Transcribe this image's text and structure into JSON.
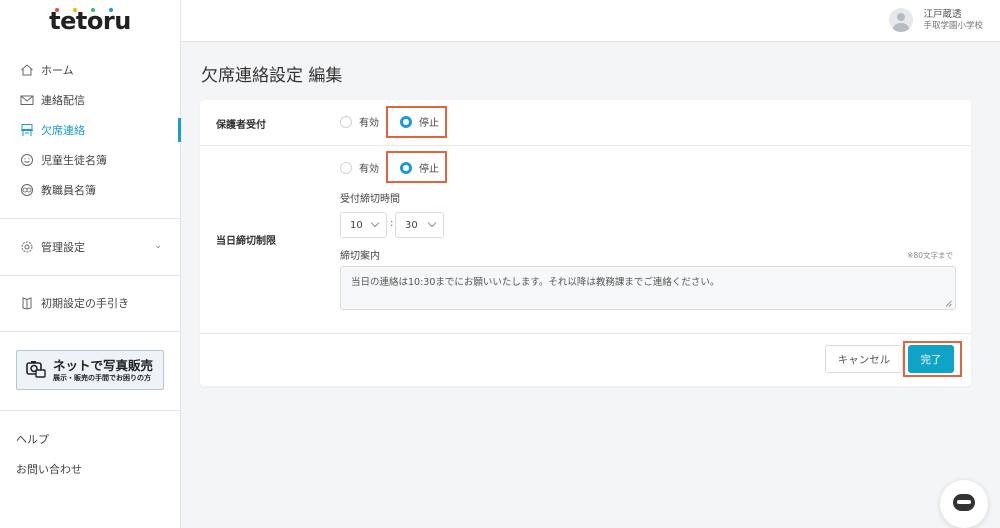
{
  "app": {
    "logo_text": "tetoru",
    "logo_dot_colors": [
      "#e94b3c",
      "#f2b705",
      "#3cb371",
      "#1b9bd1"
    ]
  },
  "sidebar": {
    "items": [
      {
        "label": "ホーム",
        "icon": "home-icon"
      },
      {
        "label": "連絡配信",
        "icon": "mail-icon"
      },
      {
        "label": "欠席連絡",
        "icon": "desk-icon",
        "active": true
      },
      {
        "label": "児童生徒名簿",
        "icon": "smile-icon"
      },
      {
        "label": "教職員名簿",
        "icon": "faces-icon"
      }
    ],
    "settings_label": "管理設定",
    "guide_label": "初期設定の手引き",
    "banner": {
      "title": "ネットで写真販売",
      "subtitle": "展示・販売の手間でお困りの方"
    },
    "help_label": "ヘルプ",
    "contact_label": "お問い合わせ"
  },
  "header": {
    "user_name": "江戸蔵透",
    "school": "手取学園小学校"
  },
  "page": {
    "title": "欠席連絡設定 編集"
  },
  "form": {
    "guardian": {
      "label": "保護者受付",
      "options": [
        "有効",
        "停止"
      ],
      "selected": "停止"
    },
    "same_day": {
      "label": "当日締切制限",
      "options": [
        "有効",
        "停止"
      ],
      "selected": "停止",
      "deadline_label": "受付締切時間",
      "hour": "10",
      "minute": "30",
      "colon": ":",
      "notice_label": "締切案内",
      "notice_limit": "※80文字まで",
      "notice_text": "当日の連絡は10:30までにお願いいたします。それ以降は教務課までご連絡ください。"
    }
  },
  "actions": {
    "cancel": "キャンセル",
    "done": "完了"
  },
  "colors": {
    "accent": "#1b9bd1",
    "primary_button": "#0fa3c7",
    "highlight": "#e0643f"
  }
}
